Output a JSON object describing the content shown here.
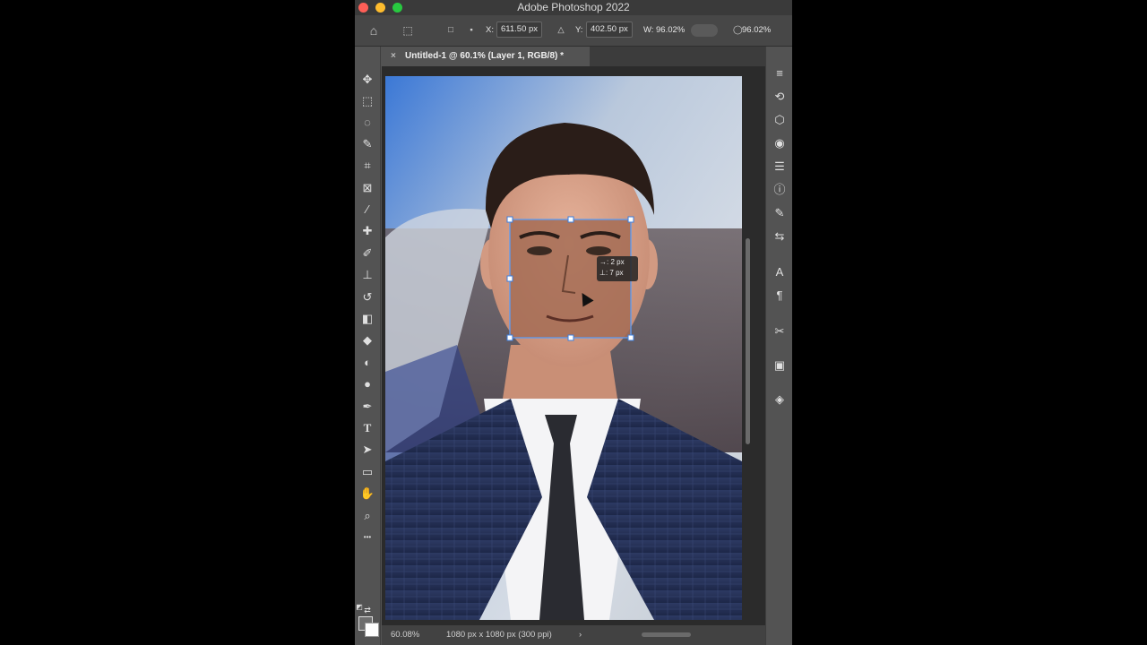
{
  "app": {
    "title": "Adobe Photoshop 2022"
  },
  "options": {
    "x_label": "X:",
    "x_value": "611.50 px",
    "y_label": "Y:",
    "y_value": "402.50 px",
    "w_label": "W:",
    "w_value": "96.02%",
    "rotate_value": "96.02%",
    "delta_symbol": "△"
  },
  "document": {
    "tab_title": "Untitled-1 @ 60.1% (Layer 1, RGB/8) *",
    "close_glyph": "×"
  },
  "transform_readout": {
    "dx": "→: 2 px",
    "dy": "⊥: 7 px"
  },
  "status": {
    "zoom": "60.08%",
    "info": "1080 px x 1080 px (300 ppi)",
    "arrow": "›"
  },
  "tools": [
    {
      "name": "move-tool",
      "glyph": "✥"
    },
    {
      "name": "marquee-tool",
      "glyph": "⬚"
    },
    {
      "name": "lasso-tool",
      "glyph": "◌"
    },
    {
      "name": "quick-select-tool",
      "glyph": "✎"
    },
    {
      "name": "crop-tool",
      "glyph": "⌗"
    },
    {
      "name": "frame-tool",
      "glyph": "⊠"
    },
    {
      "name": "eyedropper-tool",
      "glyph": "⁄"
    },
    {
      "name": "healing-brush-tool",
      "glyph": "✚"
    },
    {
      "name": "brush-tool",
      "glyph": "✐"
    },
    {
      "name": "clone-stamp-tool",
      "glyph": "⊥"
    },
    {
      "name": "history-brush-tool",
      "glyph": "↺"
    },
    {
      "name": "eraser-tool",
      "glyph": "◧"
    },
    {
      "name": "paint-bucket-tool",
      "glyph": "◆"
    },
    {
      "name": "blur-tool",
      "glyph": "◐"
    },
    {
      "name": "dodge-tool",
      "glyph": "●"
    },
    {
      "name": "pen-tool",
      "glyph": "✒"
    },
    {
      "name": "type-tool",
      "glyph": "T"
    },
    {
      "name": "path-select-tool",
      "glyph": "➤"
    },
    {
      "name": "rectangle-tool",
      "glyph": "▭"
    },
    {
      "name": "hand-tool",
      "glyph": "✋"
    },
    {
      "name": "zoom-tool",
      "glyph": "⌕"
    },
    {
      "name": "more-tools",
      "glyph": "•••"
    }
  ],
  "panels": [
    {
      "name": "properties-panel",
      "glyph": "≡"
    },
    {
      "name": "history-panel",
      "glyph": "⟲"
    },
    {
      "name": "3d-panel",
      "glyph": "⬡"
    },
    {
      "name": "color-panel",
      "glyph": "◉"
    },
    {
      "name": "adjustments-panel",
      "glyph": "☰"
    },
    {
      "name": "info-panel",
      "glyph": "ⓘ"
    },
    {
      "name": "brush-settings-panel",
      "glyph": "✎"
    },
    {
      "name": "paths-panel",
      "glyph": "⇆"
    },
    {
      "name": "character-panel",
      "glyph": "A"
    },
    {
      "name": "paragraph-panel",
      "glyph": "¶"
    },
    {
      "name": "tool-presets-panel",
      "glyph": "✂"
    },
    {
      "name": "libraries-panel",
      "glyph": "▣"
    },
    {
      "name": "layers-panel",
      "glyph": "◈"
    }
  ]
}
